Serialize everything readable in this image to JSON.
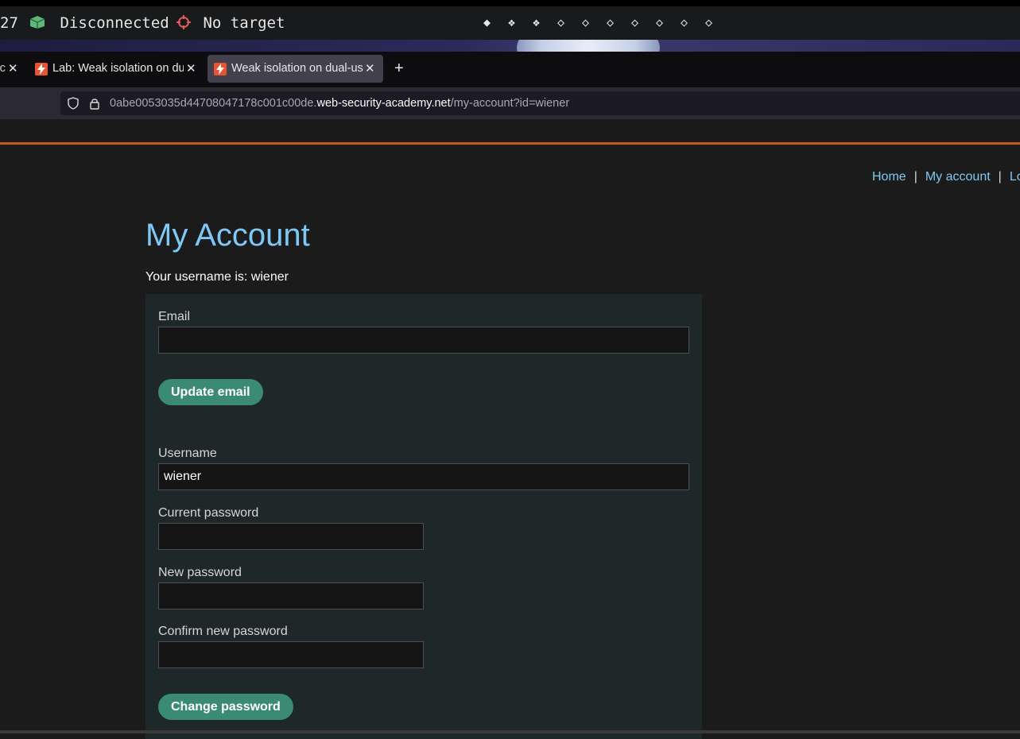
{
  "statusbar": {
    "clock_fragment": "27",
    "connection_status": "Disconnected",
    "target_status": "No target",
    "workspaces": [
      "◆",
      "❖",
      "❖",
      "◇",
      "◇",
      "◇",
      "◇",
      "◇",
      "◇",
      "◇"
    ]
  },
  "tabs": [
    {
      "title": "Ac",
      "close": "✕"
    },
    {
      "title": "Lab: Weak isolation on du",
      "close": "✕"
    },
    {
      "title": "Weak isolation on dual-us",
      "close": "✕"
    }
  ],
  "new_tab": "+",
  "url": {
    "prefix": "0abe0053035d44708047178c001c00de.",
    "host": "web-security-academy.net",
    "path": "/my-account?id=wiener"
  },
  "nav": {
    "home": "Home",
    "sep1": "|",
    "my_account": "My account",
    "sep2": "|",
    "logout": "Lo"
  },
  "page": {
    "title": "My Account",
    "username_text": "Your username is: wiener",
    "email_label": "Email",
    "email_value": "",
    "update_email_button": "Update email",
    "username_label": "Username",
    "username_value": "wiener",
    "current_password_label": "Current password",
    "new_password_label": "New password",
    "confirm_password_label": "Confirm new password",
    "change_password_button": "Change password"
  },
  "colors": {
    "accent_blue": "#7fc8f5",
    "button_green": "#3b8a74",
    "orange_line": "#c55a1e"
  }
}
